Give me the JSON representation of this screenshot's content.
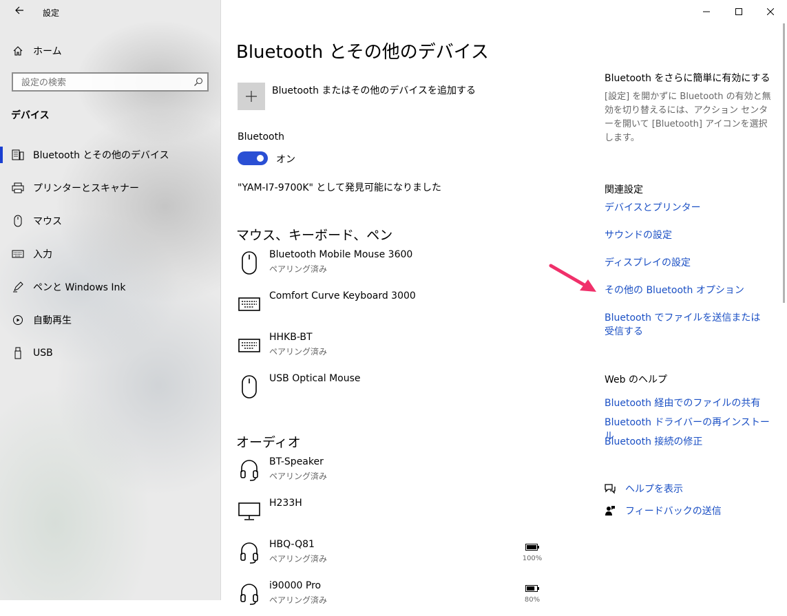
{
  "window": {
    "title": "設定"
  },
  "nav": {
    "home": "ホーム",
    "search_placeholder": "設定の検索",
    "group_title": "デバイス",
    "items": [
      {
        "label": "Bluetooth とその他のデバイス",
        "icon": "bluetooth-devices-icon",
        "selected": true
      },
      {
        "label": "プリンターとスキャナー",
        "icon": "printer-icon"
      },
      {
        "label": "マウス",
        "icon": "mouse-icon"
      },
      {
        "label": "入力",
        "icon": "keyboard-icon"
      },
      {
        "label": "ペンと Windows Ink",
        "icon": "pen-icon"
      },
      {
        "label": "自動再生",
        "icon": "autoplay-icon"
      },
      {
        "label": "USB",
        "icon": "usb-icon"
      }
    ]
  },
  "main": {
    "title": "Bluetooth とその他のデバイス",
    "add_device": "Bluetooth またはその他のデバイスを追加する",
    "bluetooth_label": "Bluetooth",
    "bluetooth_state": "オン",
    "bluetooth_on": true,
    "discoverable": "\"YAM-I7-9700K\" として発見可能になりました",
    "sections": [
      {
        "title": "マウス、キーボード、ペン",
        "devices": [
          {
            "name": "Bluetooth Mobile Mouse 3600",
            "status": "ペアリング済み",
            "icon": "mouse-icon"
          },
          {
            "name": "Comfort Curve Keyboard 3000",
            "status": "",
            "icon": "keyboard-icon"
          },
          {
            "name": "HHKB-BT",
            "status": "ペアリング済み",
            "icon": "keyboard-icon"
          },
          {
            "name": "USB Optical Mouse",
            "status": "",
            "icon": "mouse-icon"
          }
        ]
      },
      {
        "title": "オーディオ",
        "devices": [
          {
            "name": "BT-Speaker",
            "status": "ペアリング済み",
            "icon": "headset-icon"
          },
          {
            "name": "H233H",
            "status": "",
            "icon": "monitor-icon"
          },
          {
            "name": "HBQ-Q81",
            "status": "ペアリング済み",
            "icon": "headset-icon",
            "battery": "100%",
            "battery_level": 1.0
          },
          {
            "name": "i90000 Pro",
            "status": "ペアリング済み",
            "icon": "headset-icon",
            "battery": "80%",
            "battery_level": 0.8
          }
        ]
      }
    ]
  },
  "side": {
    "quick_title": "Bluetooth をさらに簡単に有効にする",
    "quick_desc": "[設定] を開かずに Bluetooth の有効と無効を切り替えるには、アクション センターを開いて [Bluetooth] アイコンを選択します。",
    "related_title": "関連設定",
    "related_links": [
      "デバイスとプリンター",
      "サウンドの設定",
      "ディスプレイの設定",
      "その他の Bluetooth オプション",
      "Bluetooth でファイルを送信または受信する"
    ],
    "web_title": "Web のヘルプ",
    "web_links": [
      "Bluetooth 経由でのファイルの共有",
      "Bluetooth ドライバーの再インストール",
      "Bluetooth 接続の修正"
    ],
    "help": "ヘルプを表示",
    "feedback": "フィードバックの送信"
  },
  "colors": {
    "accent": "#1a4fc4",
    "toggle": "#2a4fd4",
    "annotation_arrow": "#f0306a"
  }
}
